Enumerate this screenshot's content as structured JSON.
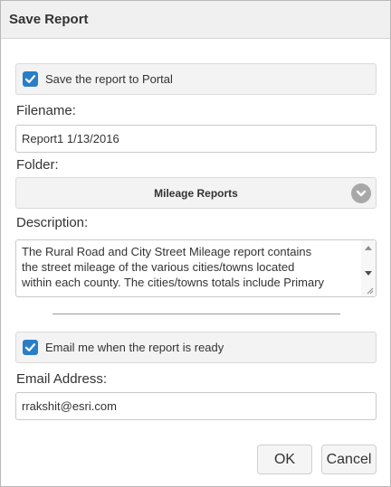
{
  "dialog": {
    "title": "Save Report"
  },
  "save_to_portal": {
    "label": "Save the report to Portal",
    "checked": true,
    "icon": "checkmark-icon"
  },
  "filename": {
    "label": "Filename:",
    "value": "Report1 1/13/2016"
  },
  "folder": {
    "label": "Folder:",
    "selected": "Mileage Reports",
    "icon": "chevron-down-icon"
  },
  "description": {
    "label": "Description:",
    "lines": [
      "The Rural Road and City Street Mileage report contains",
      "the street mileage of the various cities/towns located",
      "within each county. The cities/towns totals include Primary"
    ]
  },
  "email_me": {
    "label": "Email me when the report is ready",
    "checked": true
  },
  "email": {
    "label": "Email Address:",
    "value": "rrakshit@esri.com"
  },
  "buttons": {
    "ok": "OK",
    "cancel": "Cancel"
  },
  "colors": {
    "accent": "#2a7ec7",
    "panel_bg": "#f3f3f3",
    "titlebar_bg": "#f0f0f0"
  }
}
